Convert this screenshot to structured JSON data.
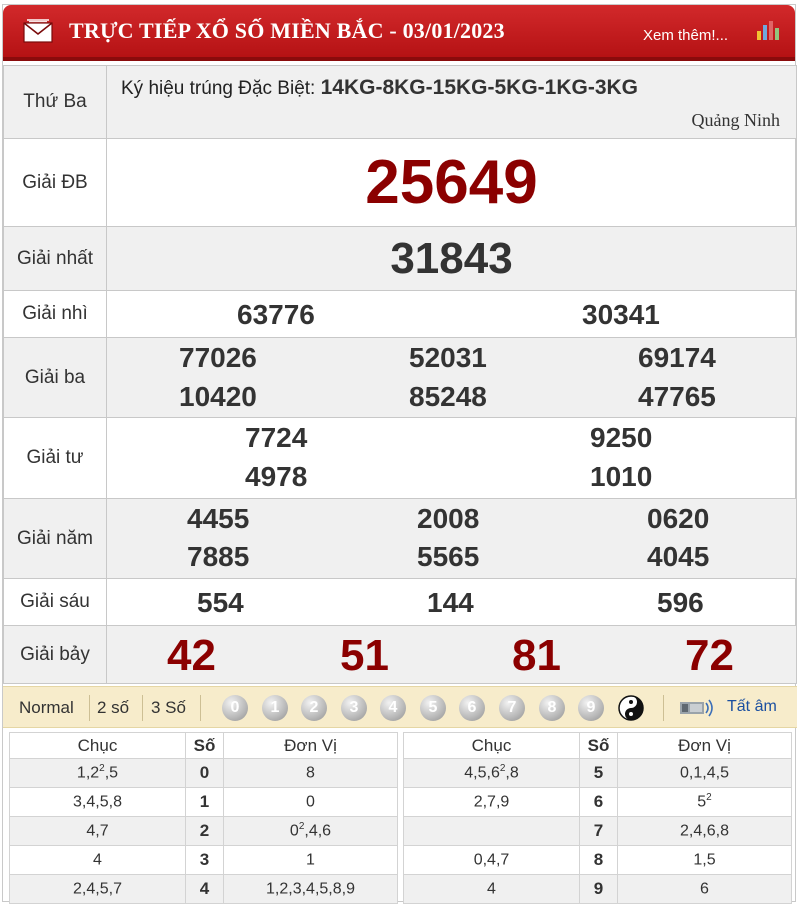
{
  "header": {
    "title": "TRỰC TIẾP XỔ SỐ MIỀN BẮC - 03/01/2023",
    "more_link": "Xem thêm!...",
    "colors": {
      "header_red": "#c41e20",
      "number_red": "#8b0000"
    },
    "icons": [
      "mail-icon",
      "bar-chart-icon"
    ]
  },
  "draw": {
    "day": "Thứ Ba",
    "symbol_label": "Ký hiệu trúng Đặc Biệt:",
    "symbol_value": "14KG-8KG-15KG-5KG-1KG-3KG",
    "province": "Quảng Ninh"
  },
  "prizes": {
    "db": {
      "label": "Giải ĐB",
      "numbers": [
        "25649"
      ]
    },
    "nhat": {
      "label": "Giải nhất",
      "numbers": [
        "31843"
      ]
    },
    "nhi": {
      "label": "Giải nhì",
      "numbers": [
        "63776",
        "30341"
      ]
    },
    "ba": {
      "label": "Giải ba",
      "numbers": [
        "77026",
        "52031",
        "69174",
        "10420",
        "85248",
        "47765"
      ]
    },
    "tu": {
      "label": "Giải tư",
      "numbers": [
        "7724",
        "9250",
        "4978",
        "1010"
      ]
    },
    "nam": {
      "label": "Giải năm",
      "numbers": [
        "4455",
        "2008",
        "0620",
        "7885",
        "5565",
        "4045"
      ]
    },
    "sau": {
      "label": "Giải sáu",
      "numbers": [
        "554",
        "144",
        "596"
      ]
    },
    "bay": {
      "label": "Giải bảy",
      "numbers": [
        "42",
        "51",
        "81",
        "72"
      ]
    }
  },
  "filter": {
    "options": [
      "Normal",
      "2 số",
      "3 Số"
    ],
    "digits": [
      "0",
      "1",
      "2",
      "3",
      "4",
      "5",
      "6",
      "7",
      "8",
      "9"
    ],
    "yin_yang_icon": "yin-yang-icon",
    "sound_icon": "speaker-icon",
    "sound_label": "Tất âm"
  },
  "loto": {
    "headers": {
      "chuc": "Chục",
      "so": "Số",
      "donvi": "Đơn Vị"
    },
    "left": [
      {
        "chuc": "1,2",
        "chuc_sup": "2",
        "chuc_tail": ",5",
        "so": "0",
        "donvi": "8",
        "donvi_sup": "",
        "donvi_tail": ""
      },
      {
        "chuc": "3,4,5,8",
        "chuc_sup": "",
        "chuc_tail": "",
        "so": "1",
        "donvi": "0",
        "donvi_sup": "",
        "donvi_tail": ""
      },
      {
        "chuc": "4,7",
        "chuc_sup": "",
        "chuc_tail": "",
        "so": "2",
        "donvi": "0",
        "donvi_sup": "2",
        "donvi_tail": ",4,6"
      },
      {
        "chuc": "4",
        "chuc_sup": "",
        "chuc_tail": "",
        "so": "3",
        "donvi": "1",
        "donvi_sup": "",
        "donvi_tail": ""
      },
      {
        "chuc": "2,4,5,7",
        "chuc_sup": "",
        "chuc_tail": "",
        "so": "4",
        "donvi": "1,2,3,4,5,8,9",
        "donvi_sup": "",
        "donvi_tail": ""
      }
    ],
    "right": [
      {
        "chuc": "4,5,6",
        "chuc_sup": "2",
        "chuc_tail": ",8",
        "so": "5",
        "donvi": "0,1,4,5",
        "donvi_sup": "",
        "donvi_tail": ""
      },
      {
        "chuc": "2,7,9",
        "chuc_sup": "",
        "chuc_tail": "",
        "so": "6",
        "donvi": "5",
        "donvi_sup": "2",
        "donvi_tail": ""
      },
      {
        "chuc": "",
        "chuc_sup": "",
        "chuc_tail": "",
        "so": "7",
        "donvi": "2,4,6,8",
        "donvi_sup": "",
        "donvi_tail": ""
      },
      {
        "chuc": "0,4,7",
        "chuc_sup": "",
        "chuc_tail": "",
        "so": "8",
        "donvi": "1,5",
        "donvi_sup": "",
        "donvi_tail": ""
      },
      {
        "chuc": "4",
        "chuc_sup": "",
        "chuc_tail": "",
        "so": "9",
        "donvi": "6",
        "donvi_sup": "",
        "donvi_tail": ""
      }
    ]
  }
}
